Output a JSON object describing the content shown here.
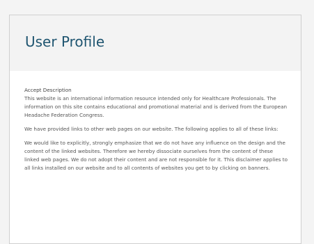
{
  "profile": {
    "title": "User Profile"
  },
  "disclaimer": {
    "heading": "Accept Description",
    "paragraphs": [
      "This website is an international information resource intended only for Healthcare Professionals. The information on this site contains educational and promotional material and is derived from the European  Headache Federation Congress.",
      "We have provided links to other web pages on our website. The following applies to all of these links:",
      "We would like to explicitly, strongly emphasize that we do not have any influence on the design and the content of the linked websites. Therefore we hereby dissociate ourselves from the content of these linked web pages. We do not adopt their content and are not responsible for it. This disclaimer applies to all links installed on our website and to all contents of websites you get to by clicking on banners."
    ]
  }
}
